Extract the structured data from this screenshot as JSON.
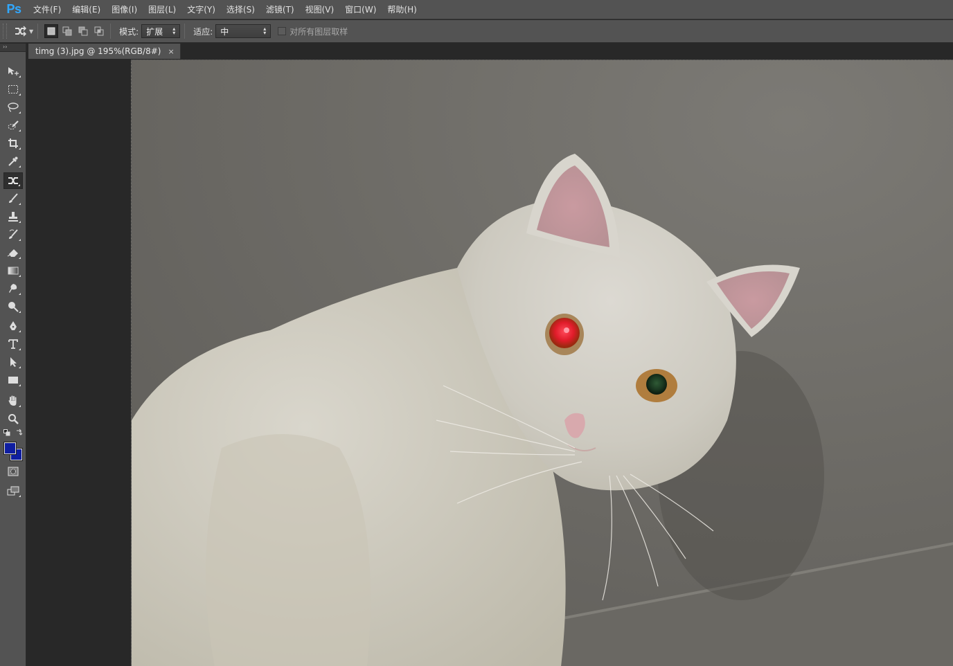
{
  "app": {
    "logo": "Ps",
    "menu": [
      "文件(F)",
      "编辑(E)",
      "图像(I)",
      "图层(L)",
      "文字(Y)",
      "选择(S)",
      "滤镜(T)",
      "视图(V)",
      "窗口(W)",
      "帮助(H)"
    ]
  },
  "options": {
    "tool_icon": "quick-selection-refine-icon",
    "mode_label": "模式:",
    "mode_value": "扩展",
    "adapt_label": "适应:",
    "adapt_value": "中",
    "sample_all_label": "对所有图层取样",
    "sample_all_checked": false
  },
  "document": {
    "tab_title": "timg (3).jpg @ 195%(RGB/8#)",
    "close_glyph": "×"
  },
  "toolbox": {
    "collapse_glyph": "››",
    "active_tool": "content-aware-move-icon",
    "foreground_color": "#0f1ea0",
    "background_color": "#0f1ea0"
  },
  "colors": {
    "accent": "#31a8ff",
    "panel": "#535353",
    "workspace": "#282828"
  }
}
